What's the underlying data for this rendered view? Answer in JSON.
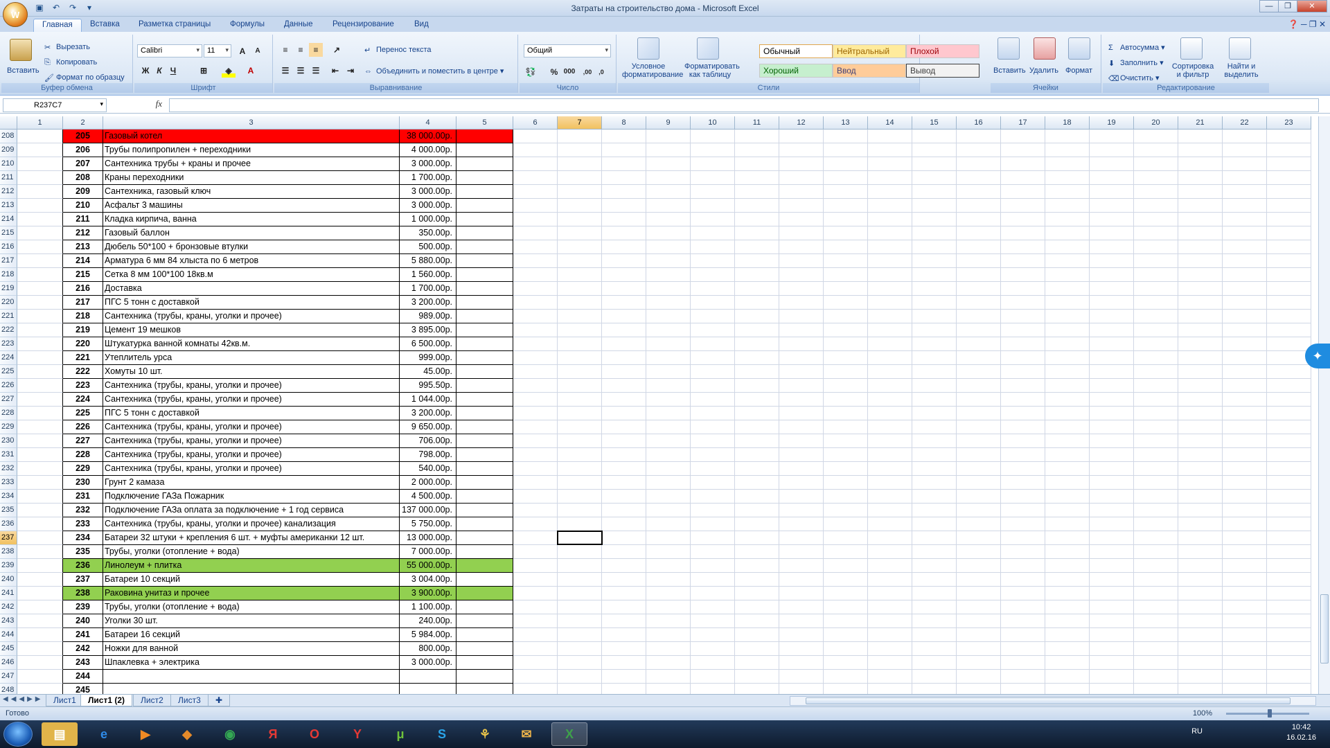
{
  "window": {
    "title": "Затраты на строительство дома - Microsoft Excel",
    "office_button_label": "W"
  },
  "tabs": [
    "Главная",
    "Вставка",
    "Разметка страницы",
    "Формулы",
    "Данные",
    "Рецензирование",
    "Вид"
  ],
  "ribbon": {
    "clipboard": {
      "label": "Буфер обмена",
      "paste": "Вставить",
      "cut": "Вырезать",
      "copy": "Копировать",
      "format_painter": "Формат по образцу"
    },
    "font": {
      "label": "Шрифт",
      "font_name": "Calibri",
      "font_size": "11",
      "bold": "Ж",
      "italic": "К",
      "underline": "Ч",
      "font_color_glyph": "A"
    },
    "alignment": {
      "label": "Выравнивание",
      "wrap_text": "Перенос текста",
      "merge_center": "Объединить и поместить в центре"
    },
    "number": {
      "label": "Число",
      "format": "Общий",
      "percent": "%",
      "thousands": "000"
    },
    "styles": {
      "label": "Стили",
      "conditional": [
        "Условное",
        "форматирование"
      ],
      "format_table": [
        "Форматировать",
        "как таблицу"
      ],
      "normal": "Обычный",
      "neutral": "Нейтральный",
      "bad": "Плохой",
      "good": "Хороший",
      "input": "Ввод",
      "output": "Вывод"
    },
    "cells": {
      "label": "Ячейки",
      "insert": "Вставить",
      "delete": "Удалить",
      "format": "Формат"
    },
    "editing": {
      "label": "Редактирование",
      "autosum": "Автосумма",
      "fill": "Заполнить",
      "clear": "Очистить",
      "sort": [
        "Сортировка",
        "и фильтр"
      ],
      "find": [
        "Найти и",
        "выделить"
      ]
    }
  },
  "formula_bar": {
    "name_box": "R237C7",
    "fx": "fx",
    "content": ""
  },
  "columns": [
    "1",
    "2",
    "3",
    "4",
    "5",
    "6",
    "7",
    "8",
    "9",
    "10",
    "11",
    "12",
    "13",
    "14",
    "15",
    "16",
    "17",
    "18",
    "19",
    "20",
    "21",
    "22",
    "23"
  ],
  "selected_column": "7",
  "selected_row": "237",
  "rows": [
    {
      "r": "208",
      "n": "205",
      "d": "Газовый котел",
      "a": "38 000.00р.",
      "hl": "red"
    },
    {
      "r": "209",
      "n": "206",
      "d": "Трубы полипропилен + переходники",
      "a": "4 000.00р.",
      "hl": ""
    },
    {
      "r": "210",
      "n": "207",
      "d": "Сантехника трубы + краны и прочее",
      "a": "3 000.00р.",
      "hl": ""
    },
    {
      "r": "211",
      "n": "208",
      "d": "Краны переходники",
      "a": "1 700.00р.",
      "hl": ""
    },
    {
      "r": "212",
      "n": "209",
      "d": "Сантехника, газовый ключ",
      "a": "3 000.00р.",
      "hl": ""
    },
    {
      "r": "213",
      "n": "210",
      "d": "Асфальт 3 машины",
      "a": "3 000.00р.",
      "hl": ""
    },
    {
      "r": "214",
      "n": "211",
      "d": "Кладка кирпича, ванна",
      "a": "1 000.00р.",
      "hl": ""
    },
    {
      "r": "215",
      "n": "212",
      "d": "Газовый баллон",
      "a": "350.00р.",
      "hl": ""
    },
    {
      "r": "216",
      "n": "213",
      "d": "Дюбель 50*100 + бронзовые втулки",
      "a": "500.00р.",
      "hl": ""
    },
    {
      "r": "217",
      "n": "214",
      "d": "Арматура 6 мм 84 хлыста по 6 метров",
      "a": "5 880.00р.",
      "hl": ""
    },
    {
      "r": "218",
      "n": "215",
      "d": "Сетка 8 мм 100*100 18кв.м",
      "a": "1 560.00р.",
      "hl": ""
    },
    {
      "r": "219",
      "n": "216",
      "d": "Доставка",
      "a": "1 700.00р.",
      "hl": ""
    },
    {
      "r": "220",
      "n": "217",
      "d": "ПГС 5 тонн с доставкой",
      "a": "3 200.00р.",
      "hl": ""
    },
    {
      "r": "221",
      "n": "218",
      "d": "Сантехника (трубы, краны, уголки и прочее)",
      "a": "989.00р.",
      "hl": ""
    },
    {
      "r": "222",
      "n": "219",
      "d": "Цемент 19 мешков",
      "a": "3 895.00р.",
      "hl": ""
    },
    {
      "r": "223",
      "n": "220",
      "d": "Штукатурка ванной комнаты 42кв.м.",
      "a": "6 500.00р.",
      "hl": ""
    },
    {
      "r": "224",
      "n": "221",
      "d": "Утеплитель урса",
      "a": "999.00р.",
      "hl": ""
    },
    {
      "r": "225",
      "n": "222",
      "d": "Хомуты 10 шт.",
      "a": "45.00р.",
      "hl": ""
    },
    {
      "r": "226",
      "n": "223",
      "d": "Сантехника (трубы, краны, уголки и прочее)",
      "a": "995.50р.",
      "hl": ""
    },
    {
      "r": "227",
      "n": "224",
      "d": "Сантехника (трубы, краны, уголки и прочее)",
      "a": "1 044.00р.",
      "hl": ""
    },
    {
      "r": "228",
      "n": "225",
      "d": "ПГС 5 тонн с доставкой",
      "a": "3 200.00р.",
      "hl": ""
    },
    {
      "r": "229",
      "n": "226",
      "d": "Сантехника (трубы, краны, уголки и прочее)",
      "a": "9 650.00р.",
      "hl": ""
    },
    {
      "r": "230",
      "n": "227",
      "d": "Сантехника (трубы, краны, уголки и прочее)",
      "a": "706.00р.",
      "hl": ""
    },
    {
      "r": "231",
      "n": "228",
      "d": "Сантехника (трубы, краны, уголки и прочее)",
      "a": "798.00р.",
      "hl": ""
    },
    {
      "r": "232",
      "n": "229",
      "d": "Сантехника (трубы, краны, уголки и прочее)",
      "a": "540.00р.",
      "hl": ""
    },
    {
      "r": "233",
      "n": "230",
      "d": "Грунт 2 камаза",
      "a": "2 000.00р.",
      "hl": ""
    },
    {
      "r": "234",
      "n": "231",
      "d": "Подключение ГАЗа Пожарник",
      "a": "4 500.00р.",
      "hl": ""
    },
    {
      "r": "235",
      "n": "232",
      "d": "Подключение ГАЗа оплата за подключение + 1 год сервиса",
      "a": "137 000.00р.",
      "hl": ""
    },
    {
      "r": "236",
      "n": "233",
      "d": "Сантехника (трубы, краны, уголки и прочее) канализация",
      "a": "5 750.00р.",
      "hl": ""
    },
    {
      "r": "237",
      "n": "234",
      "d": "Батареи 32 штуки + крепления 6 шт. + муфты американки 12 шт.",
      "a": "13 000.00р.",
      "hl": ""
    },
    {
      "r": "238",
      "n": "235",
      "d": "Трубы, уголки (отопление + вода)",
      "a": "7 000.00р.",
      "hl": ""
    },
    {
      "r": "239",
      "n": "236",
      "d": "Линолеум + плитка",
      "a": "55 000.00р.",
      "hl": "green"
    },
    {
      "r": "240",
      "n": "237",
      "d": "Батареи 10 секций",
      "a": "3 004.00р.",
      "hl": ""
    },
    {
      "r": "241",
      "n": "238",
      "d": "Раковина унитаз и прочее",
      "a": "3 900.00р.",
      "hl": "green"
    },
    {
      "r": "242",
      "n": "239",
      "d": "Трубы, уголки (отопление + вода)",
      "a": "1 100.00р.",
      "hl": ""
    },
    {
      "r": "243",
      "n": "240",
      "d": "Уголки 30 шт.",
      "a": "240.00р.",
      "hl": ""
    },
    {
      "r": "244",
      "n": "241",
      "d": "Батареи 16 секций",
      "a": "5 984.00р.",
      "hl": ""
    },
    {
      "r": "245",
      "n": "242",
      "d": "Ножки для ванной",
      "a": "800.00р.",
      "hl": ""
    },
    {
      "r": "246",
      "n": "243",
      "d": "Шпаклевка + электрика",
      "a": "3 000.00р.",
      "hl": ""
    },
    {
      "r": "247",
      "n": "244",
      "d": "",
      "a": "",
      "hl": ""
    },
    {
      "r": "248",
      "n": "245",
      "d": "",
      "a": "",
      "hl": ""
    }
  ],
  "sheets": [
    "Лист1",
    "Лист1 (2)",
    "Лист2",
    "Лист3"
  ],
  "active_sheet": "Лист1 (2)",
  "status": {
    "ready": "Готово",
    "zoom": "100%"
  },
  "taskbar": {
    "lang": "RU",
    "time": "10:42",
    "date": "16.02.16"
  },
  "colors": {
    "red_fill": "#ff0000",
    "green_fill": "#92d050",
    "selection": "#f1c15f"
  }
}
